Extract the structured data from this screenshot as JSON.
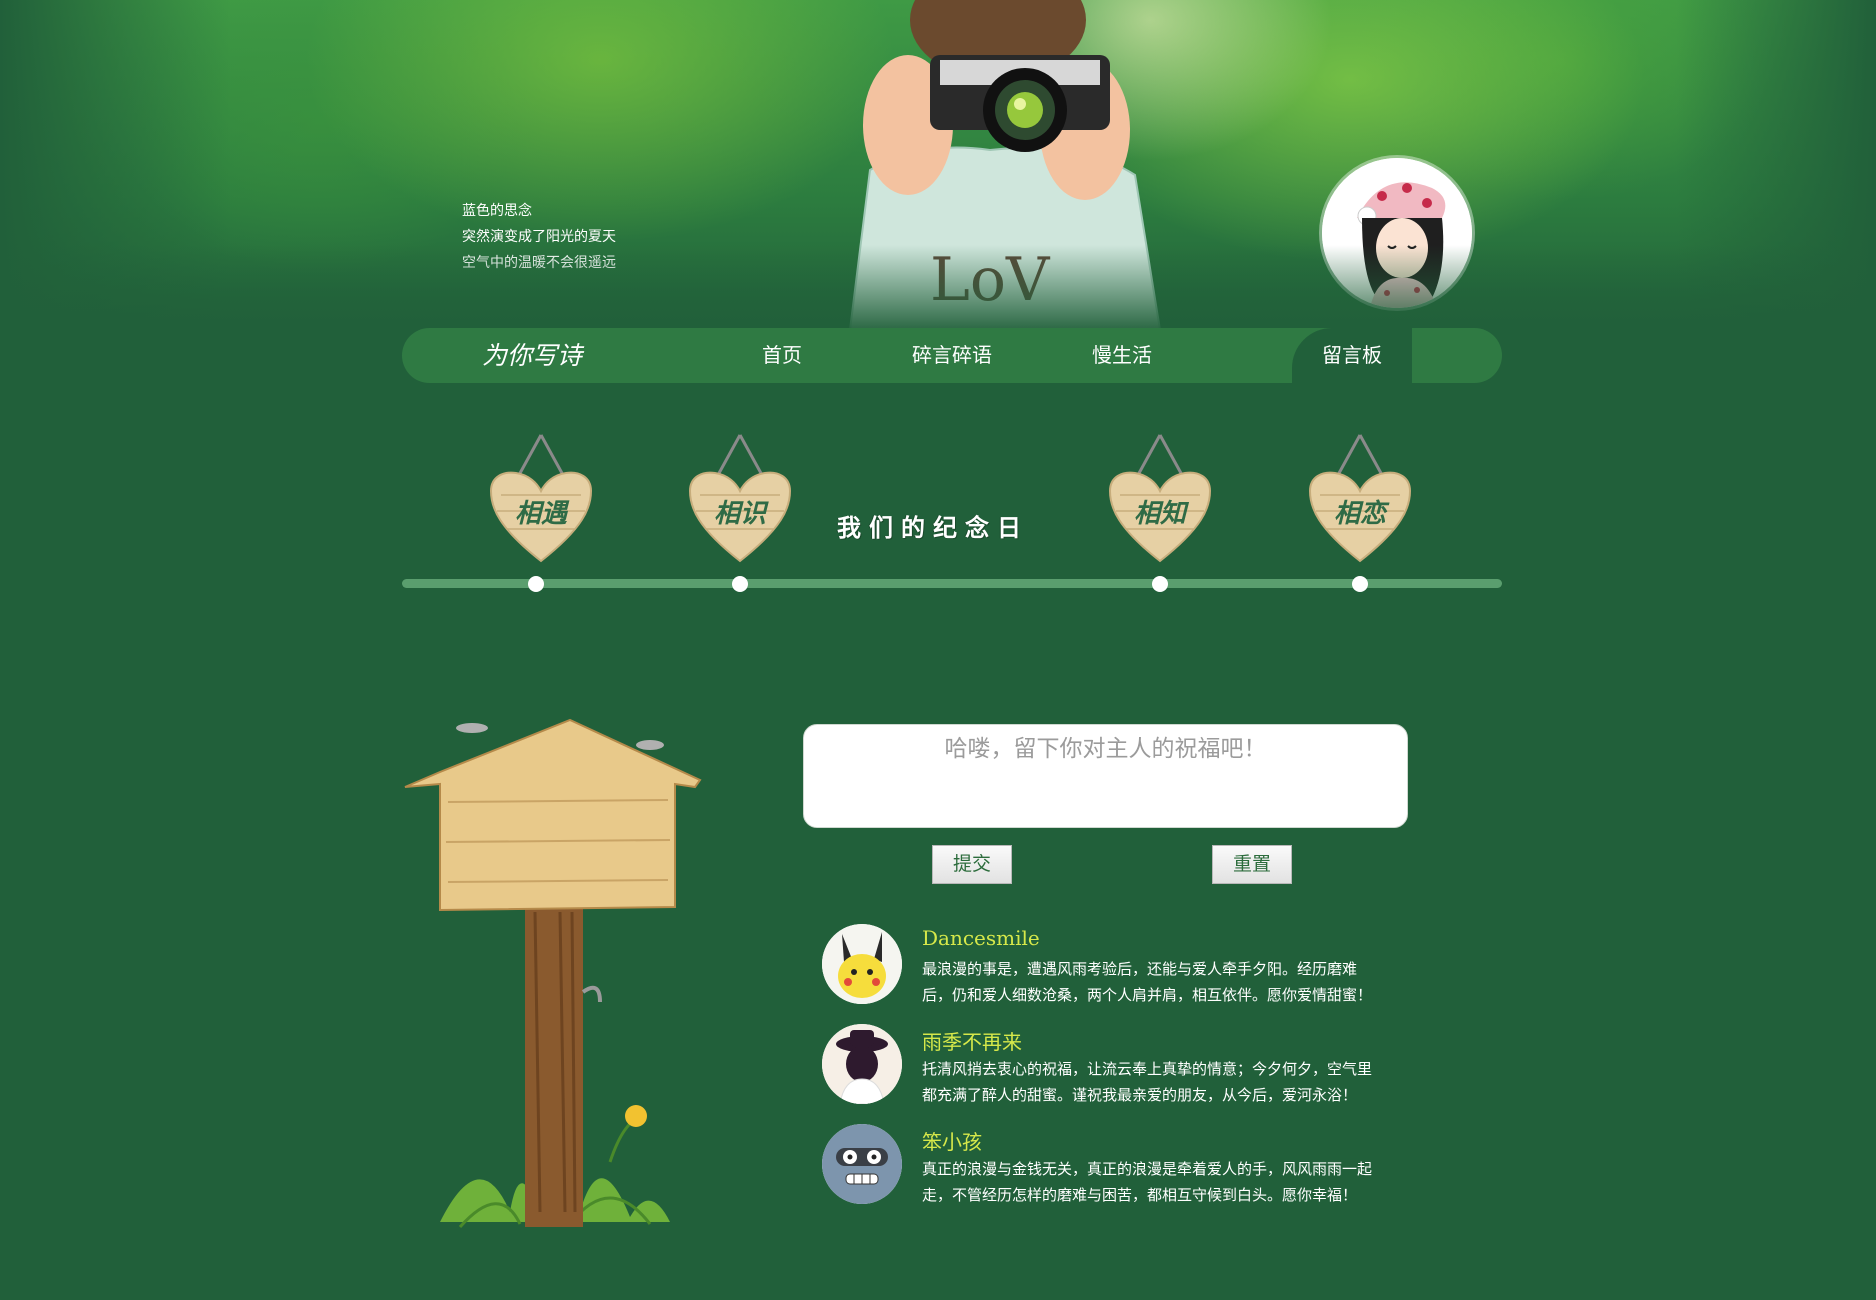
{
  "header": {
    "poem_lines": [
      "蓝色的思念",
      "突然演变成了阳光的夏天",
      "空气中的温暖不会很遥远"
    ],
    "shirt_text": "LoV"
  },
  "nav": {
    "brand": "为你写诗",
    "items": [
      {
        "label": "首页"
      },
      {
        "label": "碎言碎语"
      },
      {
        "label": "慢生活"
      },
      {
        "label": "留言板"
      }
    ],
    "active": "留言板"
  },
  "timeline": {
    "hearts": [
      {
        "label": "相遇"
      },
      {
        "label": "相识"
      },
      {
        "label": "相知"
      },
      {
        "label": "相恋"
      }
    ],
    "anniversary_chars": [
      "我",
      "们",
      "的",
      "纪",
      "念",
      "日"
    ]
  },
  "form": {
    "placeholder": "哈喽，留下你对主人的祝福吧！",
    "submit_label": "提交",
    "reset_label": "重置"
  },
  "comments": [
    {
      "name": "Dancesmile",
      "avatar_icon": "pikachu-icon",
      "lines": [
        "最浪漫的事是，遭遇风雨考验后，还能与爱人牵手夕阳。经历磨难",
        "后，仍和爱人细数沧桑，两个人肩并肩，相互依伴。愿你爱情甜蜜！"
      ]
    },
    {
      "name": "雨季不再来",
      "avatar_icon": "hat-girl-icon",
      "lines": [
        "托清风捎去衷心的祝福，让流云奉上真挚的情意；今夕何夕，空气里",
        "都充满了醉人的甜蜜。谨祝我最亲爱的朋友，从今后，爱河永浴！"
      ]
    },
    {
      "name": "笨小孩",
      "avatar_icon": "robot-face-icon",
      "lines": [
        "真正的浪漫与金钱无关，真正的浪漫是牵着爱人的手，风风雨雨一起",
        "走，不管经历怎样的磨难与困苦，都相互守候到白头。愿你幸福！"
      ]
    }
  ],
  "colors": {
    "background": "#21603a",
    "nav": "#2f7a43",
    "comment_name": "#d6e84a",
    "heart_wood": "#e6d0a4"
  }
}
